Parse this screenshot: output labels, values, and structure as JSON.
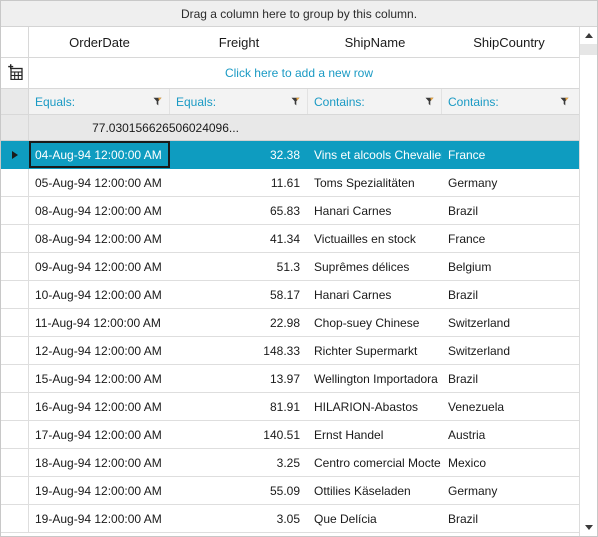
{
  "grid": {
    "group_panel_text": "Drag a column here to group by this column.",
    "new_row_text": "Click here to add a new row",
    "new_row_icon": "add-new-row-grid-icon",
    "accent_color": "#1a9ac4",
    "selection_color": "#0e9cc0",
    "columns": [
      {
        "header": "OrderDate",
        "filter_label": "Equals:",
        "filter_icon": "funnel-icon"
      },
      {
        "header": "Freight",
        "filter_label": "Equals:",
        "filter_icon": "funnel-icon"
      },
      {
        "header": "ShipName",
        "filter_label": "Contains:",
        "filter_icon": "funnel-icon"
      },
      {
        "header": "ShipCountry",
        "filter_label": "Contains:",
        "filter_icon": "funnel-icon"
      }
    ],
    "summary": {
      "value": "77.030156626506024096..."
    },
    "scrollbar": {
      "up_icon": "scroll-up-arrow-icon",
      "down_icon": "scroll-down-arrow-icon"
    },
    "rows": [
      {
        "selected": true,
        "indicator": "current-row-arrow-icon",
        "OrderDate": "04-Aug-94 12:00:00 AM",
        "Freight": "32.38",
        "ShipName": "Vins et alcools Chevalier",
        "ShipCountry": "France"
      },
      {
        "selected": false,
        "indicator": "",
        "OrderDate": "05-Aug-94 12:00:00 AM",
        "Freight": "11.61",
        "ShipName": "Toms Spezialitäten",
        "ShipCountry": "Germany"
      },
      {
        "selected": false,
        "indicator": "",
        "OrderDate": "08-Aug-94 12:00:00 AM",
        "Freight": "65.83",
        "ShipName": "Hanari Carnes",
        "ShipCountry": "Brazil"
      },
      {
        "selected": false,
        "indicator": "",
        "OrderDate": "08-Aug-94 12:00:00 AM",
        "Freight": "41.34",
        "ShipName": "Victuailles en stock",
        "ShipCountry": "France"
      },
      {
        "selected": false,
        "indicator": "",
        "OrderDate": "09-Aug-94 12:00:00 AM",
        "Freight": "51.3",
        "ShipName": "Suprêmes délices",
        "ShipCountry": "Belgium"
      },
      {
        "selected": false,
        "indicator": "",
        "OrderDate": "10-Aug-94 12:00:00 AM",
        "Freight": "58.17",
        "ShipName": "Hanari Carnes",
        "ShipCountry": "Brazil"
      },
      {
        "selected": false,
        "indicator": "",
        "OrderDate": "11-Aug-94 12:00:00 AM",
        "Freight": "22.98",
        "ShipName": "Chop-suey Chinese",
        "ShipCountry": "Switzerland"
      },
      {
        "selected": false,
        "indicator": "",
        "OrderDate": "12-Aug-94 12:00:00 AM",
        "Freight": "148.33",
        "ShipName": "Richter Supermarkt",
        "ShipCountry": "Switzerland"
      },
      {
        "selected": false,
        "indicator": "",
        "OrderDate": "15-Aug-94 12:00:00 AM",
        "Freight": "13.97",
        "ShipName": "Wellington Importadora",
        "ShipCountry": "Brazil"
      },
      {
        "selected": false,
        "indicator": "",
        "OrderDate": "16-Aug-94 12:00:00 AM",
        "Freight": "81.91",
        "ShipName": "HILARION-Abastos",
        "ShipCountry": "Venezuela"
      },
      {
        "selected": false,
        "indicator": "",
        "OrderDate": "17-Aug-94 12:00:00 AM",
        "Freight": "140.51",
        "ShipName": "Ernst Handel",
        "ShipCountry": "Austria"
      },
      {
        "selected": false,
        "indicator": "",
        "OrderDate": "18-Aug-94 12:00:00 AM",
        "Freight": "3.25",
        "ShipName": "Centro comercial Mocte…",
        "ShipCountry": "Mexico"
      },
      {
        "selected": false,
        "indicator": "",
        "OrderDate": "19-Aug-94 12:00:00 AM",
        "Freight": "55.09",
        "ShipName": "Ottilies Käseladen",
        "ShipCountry": "Germany"
      },
      {
        "selected": false,
        "indicator": "",
        "OrderDate": "19-Aug-94 12:00:00 AM",
        "Freight": "3.05",
        "ShipName": "Que Delícia",
        "ShipCountry": "Brazil"
      }
    ]
  }
}
